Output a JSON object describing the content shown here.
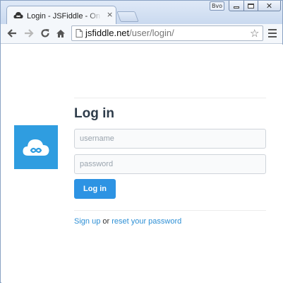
{
  "window": {
    "user_badge": "Bvo",
    "colors": {
      "frame": "#c9d9ef",
      "accent": "#2f9de0",
      "link": "#2d8fd5"
    }
  },
  "tab": {
    "title": "Login - JSFiddle - Online",
    "favicon": "jsfiddle-cloud-icon",
    "close": "×"
  },
  "toolbar": {
    "back_icon": "back-arrow-icon",
    "forward_icon": "forward-arrow-icon",
    "reload_icon": "reload-icon",
    "home_icon": "home-icon",
    "url_host": "jsfiddle.net",
    "url_path": "/user/login/",
    "star_icon": "star-icon",
    "menu_icon": "hamburger-menu-icon"
  },
  "login": {
    "heading": "Log in",
    "username_placeholder": "username",
    "password_placeholder": "password",
    "submit_label": "Log in",
    "signup_label": "Sign up",
    "or_text": " or ",
    "reset_label": "reset your password"
  }
}
